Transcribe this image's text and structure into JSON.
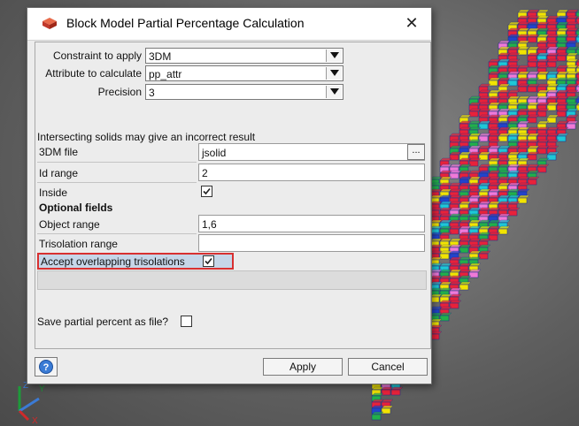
{
  "dialog": {
    "title": "Block Model Partial Percentage Calculation",
    "close_glyph": "✕",
    "app_icon": "block-model-icon"
  },
  "top_fields": {
    "constraint": {
      "label": "Constraint to apply",
      "value": "3DM"
    },
    "attribute": {
      "label": "Attribute to calculate",
      "value": "pp_attr"
    },
    "precision": {
      "label": "Precision",
      "value": "3"
    }
  },
  "warning": "Intersecting solids may give an incorrect result",
  "solid_fields": {
    "file": {
      "label": "3DM file",
      "value": "jsolid",
      "browse": "..."
    },
    "id_range": {
      "label": "Id range",
      "value": "2"
    },
    "inside": {
      "label": "Inside",
      "checked": true
    }
  },
  "optional": {
    "header": "Optional fields",
    "object_range": {
      "label": "Object range",
      "value": "1,6"
    },
    "trisolation_range": {
      "label": "Trisolation range",
      "value": ""
    },
    "accept_overlapping": {
      "label": "Accept overlapping trisolations",
      "checked": true
    }
  },
  "save_partial": {
    "label": "Save partial percent as file?",
    "checked": false
  },
  "buttons": {
    "help": "help-icon",
    "apply": "Apply",
    "cancel": "Cancel"
  },
  "colors": {
    "highlight_border": "#d83030",
    "highlight_fill": "#c6d6e8",
    "block_palette": [
      "#e8223a",
      "#f2e400",
      "#22b04a",
      "#1ec8d6",
      "#f07ad8",
      "#2244cc"
    ]
  }
}
